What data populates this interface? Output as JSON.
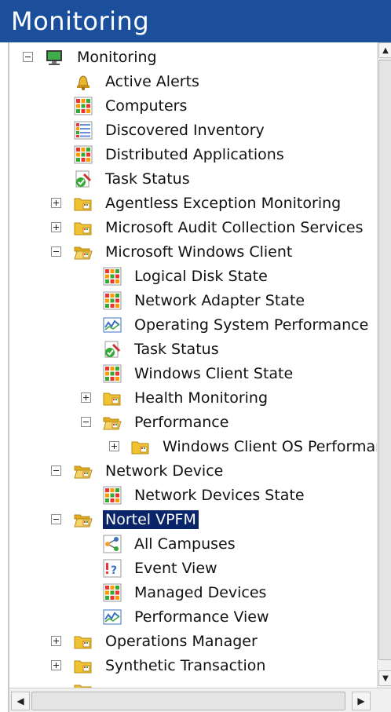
{
  "header": {
    "title": "Monitoring"
  },
  "tree": {
    "root": {
      "label": "Monitoring",
      "icon": "monitor-icon",
      "state": "expanded"
    },
    "items": [
      {
        "label": "Active Alerts",
        "icon": "bell-icon"
      },
      {
        "label": "Computers",
        "icon": "grid-view-icon"
      },
      {
        "label": "Discovered Inventory",
        "icon": "list-view-icon"
      },
      {
        "label": "Distributed Applications",
        "icon": "grid-view-icon"
      },
      {
        "label": "Task Status",
        "icon": "task-status-icon"
      },
      {
        "label": "Agentless Exception Monitoring",
        "icon": "folder-icon",
        "state": "collapsed"
      },
      {
        "label": "Microsoft Audit Collection Services",
        "icon": "folder-icon",
        "state": "collapsed"
      },
      {
        "label": "Microsoft Windows Client",
        "icon": "folder-open-icon",
        "state": "expanded"
      },
      {
        "label": "Logical Disk State",
        "icon": "grid-view-icon"
      },
      {
        "label": "Network Adapter State",
        "icon": "grid-view-icon"
      },
      {
        "label": "Operating System Performance",
        "icon": "performance-chart-icon"
      },
      {
        "label": "Task Status",
        "icon": "task-status-icon"
      },
      {
        "label": "Windows Client State",
        "icon": "grid-view-icon"
      },
      {
        "label": "Health Monitoring",
        "icon": "folder-icon",
        "state": "collapsed"
      },
      {
        "label": "Performance",
        "icon": "folder-open-icon",
        "state": "expanded"
      },
      {
        "label": "Windows Client OS Performar",
        "icon": "folder-icon",
        "state": "collapsed"
      },
      {
        "label": "Network Device",
        "icon": "folder-open-icon",
        "state": "expanded"
      },
      {
        "label": "Network Devices State",
        "icon": "grid-view-icon"
      },
      {
        "label": "Nortel VPFM",
        "icon": "folder-open-icon",
        "state": "expanded",
        "selected": true
      },
      {
        "label": "All Campuses",
        "icon": "diagram-icon"
      },
      {
        "label": "Event View",
        "icon": "event-icon"
      },
      {
        "label": "Managed Devices",
        "icon": "grid-view-icon"
      },
      {
        "label": "Performance View",
        "icon": "performance-chart-icon"
      },
      {
        "label": "Operations Manager",
        "icon": "folder-icon",
        "state": "collapsed"
      },
      {
        "label": "Synthetic Transaction",
        "icon": "folder-icon",
        "state": "collapsed"
      }
    ]
  },
  "colors": {
    "header_bg": "#1b4f9c",
    "selection_bg": "#0a246a",
    "folder": "#f1c232"
  }
}
